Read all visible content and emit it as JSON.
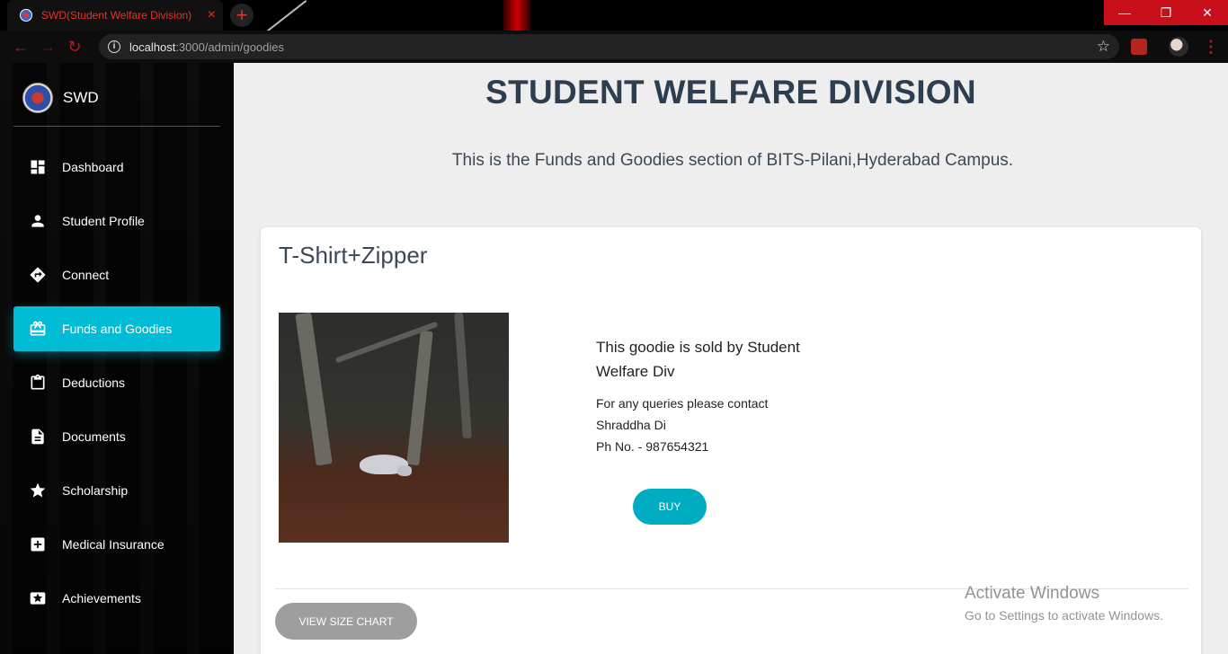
{
  "browser": {
    "tab_title": "SWD(Student Welfare Division)",
    "tab_close": "×",
    "new_tab": "+",
    "url_host": "localhost",
    "url_path": ":3000/admin/goodies",
    "window_buttons": [
      "—",
      "❐",
      "✕"
    ]
  },
  "sidebar": {
    "brand": "SWD",
    "items": [
      {
        "label": "Dashboard",
        "icon": "dashboard-icon"
      },
      {
        "label": "Student Profile",
        "icon": "person-icon"
      },
      {
        "label": "Connect",
        "icon": "directions-icon"
      },
      {
        "label": "Funds and Goodies",
        "icon": "card-giftcard-icon",
        "active": true
      },
      {
        "label": "Deductions",
        "icon": "clipboard-icon"
      },
      {
        "label": "Documents",
        "icon": "document-icon"
      },
      {
        "label": "Scholarship",
        "icon": "star-icon"
      },
      {
        "label": "Medical Insurance",
        "icon": "medical-cross-icon"
      },
      {
        "label": "Achievements",
        "icon": "award-icon"
      }
    ]
  },
  "main": {
    "title": "STUDENT WELFARE DIVISION",
    "subtitle": "This is the Funds and Goodies section of BITS-Pilani,Hyderabad Campus."
  },
  "goodie": {
    "title": "T-Shirt+Zipper",
    "sold_by": "This goodie is sold by Student Welfare Div",
    "contact_intro": "For any queries please contact",
    "contact_name": "Shraddha Di",
    "contact_phone": "Ph No. - 987654321",
    "buy_label": "BUY",
    "size_chart_label": "VIEW SIZE CHART"
  },
  "watermark": {
    "title": "Activate Windows",
    "subtitle": "Go to Settings to activate Windows."
  },
  "colors": {
    "accent": "#00bcd4",
    "browser_red": "#c8101b",
    "title_text": "#2c3e50"
  }
}
